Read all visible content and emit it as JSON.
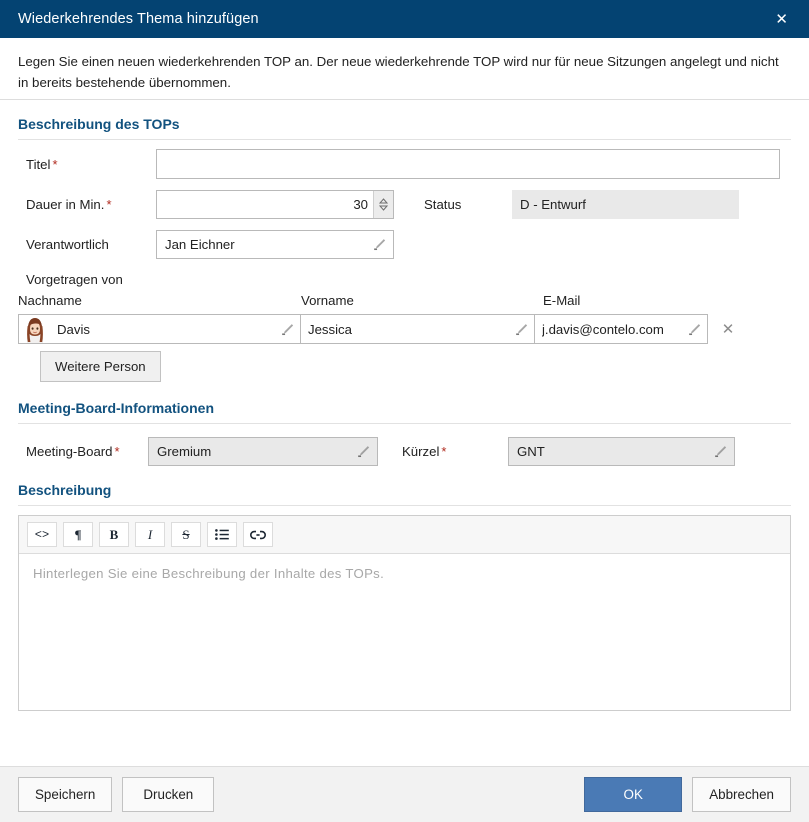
{
  "titlebar": {
    "title": "Wiederkehrendes Thema hinzufügen",
    "close_icon": "close-icon",
    "close_glyph": "✕",
    "bg_color": "#044372"
  },
  "intro": {
    "text": "Legen Sie einen neuen wiederkehrenden TOP an. Der neue wiederkehrende TOP wird nur für neue Sitzungen angelegt und nicht in bereits bestehende übernommen."
  },
  "sections": {
    "top_description": {
      "heading": "Beschreibung des TOPs",
      "fields": {
        "titel_label": "Titel",
        "titel_value": "",
        "dauer_label": "Dauer in Min.",
        "dauer_value": "30",
        "status_label": "Status",
        "status_value": "D - Entwurf",
        "verantwortlich_label": "Verantwortlich",
        "verantwortlich_value": "Jan Eichner"
      },
      "presenter": {
        "group_label": "Vorgetragen von",
        "columns": [
          "Nachname",
          "Vorname",
          "E-Mail"
        ],
        "rows": [
          {
            "nachname": "Davis",
            "vorname": "Jessica",
            "email": "j.davis@contelo.com"
          }
        ],
        "remove_glyph": "✕",
        "add_button": "Weitere Person"
      }
    },
    "meeting_board": {
      "heading": "Meeting-Board-Informationen",
      "board_label": "Meeting-Board",
      "board_value": "Gremium",
      "kuerzel_label": "Kürzel",
      "kuerzel_value": "GNT"
    },
    "description": {
      "heading": "Beschreibung",
      "toolbar": [
        {
          "name": "code-icon",
          "glyph": "<>"
        },
        {
          "name": "paragraph-icon",
          "glyph": "¶"
        },
        {
          "name": "bold-icon",
          "glyph": "B"
        },
        {
          "name": "italic-icon",
          "glyph": "I"
        },
        {
          "name": "strikethrough-icon",
          "glyph": "S"
        },
        {
          "name": "bullet-list-icon",
          "glyph": "☰"
        },
        {
          "name": "link-icon",
          "glyph": "🔗"
        }
      ],
      "placeholder": "Hinterlegen Sie eine Beschreibung der Inhalte des TOPs."
    }
  },
  "footer": {
    "save": "Speichern",
    "print": "Drucken",
    "ok": "OK",
    "cancel": "Abbrechen",
    "primary_color": "#4a7ab5"
  },
  "markers": {
    "required": "*"
  }
}
